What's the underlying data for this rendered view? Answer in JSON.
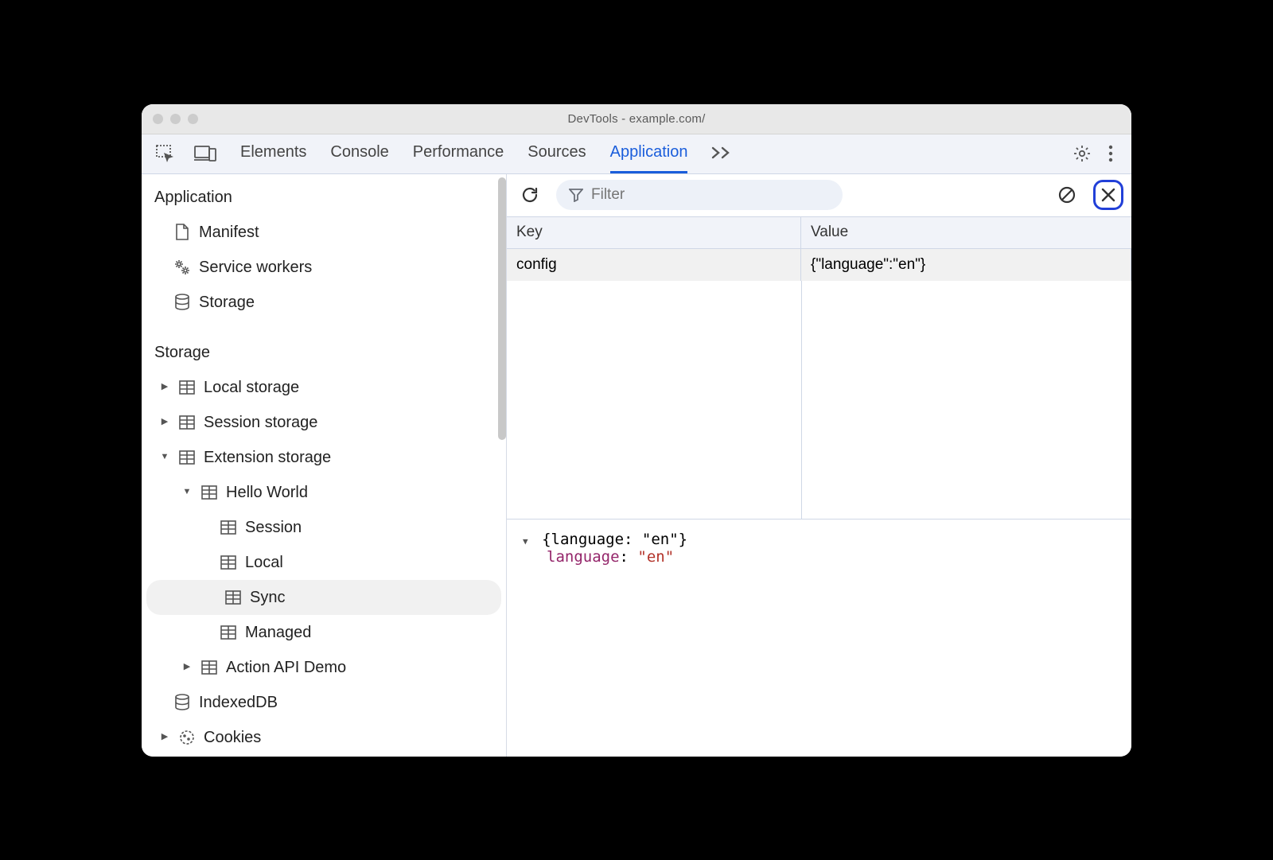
{
  "window": {
    "title": "DevTools - example.com/"
  },
  "tabs": {
    "items": [
      "Elements",
      "Console",
      "Performance",
      "Sources",
      "Application"
    ],
    "active": "Application"
  },
  "sidebar": {
    "section_application": "Application",
    "app_items": [
      {
        "label": "Manifest",
        "icon": "file"
      },
      {
        "label": "Service workers",
        "icon": "gears"
      },
      {
        "label": "Storage",
        "icon": "db"
      }
    ],
    "section_storage": "Storage",
    "storage_items": [
      {
        "label": "Local storage",
        "expand": "closed"
      },
      {
        "label": "Session storage",
        "expand": "closed"
      },
      {
        "label": "Extension storage",
        "expand": "open",
        "children": [
          {
            "label": "Hello World",
            "expand": "open",
            "children": [
              {
                "label": "Session"
              },
              {
                "label": "Local"
              },
              {
                "label": "Sync",
                "selected": true
              },
              {
                "label": "Managed"
              }
            ]
          },
          {
            "label": "Action API Demo",
            "expand": "closed"
          }
        ]
      },
      {
        "label": "IndexedDB",
        "icon": "db"
      },
      {
        "label": "Cookies",
        "icon": "cookie",
        "expand": "closed"
      }
    ]
  },
  "toolbar": {
    "filter_placeholder": "Filter"
  },
  "grid": {
    "headers": {
      "key": "Key",
      "value": "Value"
    },
    "rows": [
      {
        "key": "config",
        "value": "{\"language\":\"en\"}"
      }
    ]
  },
  "detail": {
    "summary": "{language: \"en\"}",
    "prop_key": "language",
    "prop_val": "\"en\""
  }
}
